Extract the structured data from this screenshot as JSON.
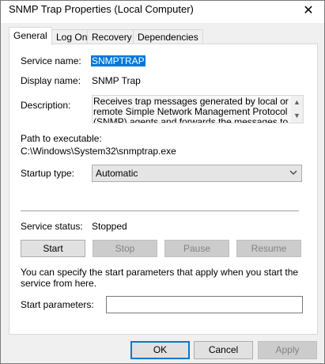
{
  "window": {
    "title": "SNMP Trap Properties (Local Computer)",
    "close_glyph": "✕"
  },
  "tabs": [
    {
      "label": "General",
      "active": true
    },
    {
      "label": "Log On",
      "active": false
    },
    {
      "label": "Recovery",
      "active": false
    },
    {
      "label": "Dependencies",
      "active": false
    }
  ],
  "general": {
    "service_name_label": "Service name:",
    "service_name_value": "SNMPTRAP",
    "display_name_label": "Display name:",
    "display_name_value": "SNMP Trap",
    "description_label": "Description:",
    "description_value": "Receives trap messages generated by local or remote Simple Network Management Protocol (SNMP) agents and forwards the messages to",
    "path_label": "Path to executable:",
    "path_value": "C:\\Windows\\System32\\snmptrap.exe",
    "startup_type_label": "Startup type:",
    "startup_type_value": "Automatic",
    "service_status_label": "Service status:",
    "service_status_value": "Stopped",
    "buttons": {
      "start": "Start",
      "stop": "Stop",
      "pause": "Pause",
      "resume": "Resume"
    },
    "start_params_help": "You can specify the start parameters that apply when you start the service from here.",
    "start_params_label": "Start parameters:",
    "start_params_value": ""
  },
  "footer": {
    "ok": "OK",
    "cancel": "Cancel",
    "apply": "Apply"
  },
  "colors": {
    "selection": "#0078d7",
    "default_button_border": "#0078d7"
  }
}
